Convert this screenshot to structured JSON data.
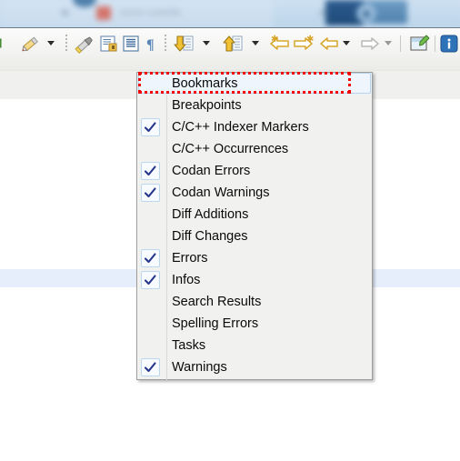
{
  "window": {
    "background_title_text": "nnnn-comtle",
    "title_strip_color": "#c6dcef"
  },
  "toolbar": {
    "items": [
      {
        "name": "pencil-marker-icon",
        "type": "icon"
      },
      {
        "name": "pencil-dropdown-arrow",
        "type": "arrow"
      },
      {
        "name": "separator-grip-1",
        "type": "grip"
      },
      {
        "name": "highlight-pen-icon",
        "type": "icon"
      },
      {
        "name": "toggle-block-selection-icon",
        "type": "icon"
      },
      {
        "name": "show-whitespace-icon",
        "type": "icon"
      },
      {
        "name": "pilcrow-icon",
        "type": "icon"
      },
      {
        "name": "separator-grip-2",
        "type": "grip"
      },
      {
        "name": "next-annotation-icon",
        "type": "icon"
      },
      {
        "name": "next-annotation-dropdown-arrow",
        "type": "arrow"
      },
      {
        "name": "previous-annotation-icon",
        "type": "icon"
      },
      {
        "name": "previous-annotation-dropdown-arrow",
        "type": "arrow"
      },
      {
        "name": "last-edit-location-icon",
        "type": "icon"
      },
      {
        "name": "forward-edit-location-icon",
        "type": "icon"
      },
      {
        "name": "back-navigation-icon",
        "type": "icon"
      },
      {
        "name": "back-navigation-dropdown-arrow",
        "type": "arrow"
      },
      {
        "name": "forward-navigation-icon",
        "type": "icon"
      },
      {
        "name": "forward-navigation-dropdown-arrow",
        "type": "arrow"
      },
      {
        "name": "separator-line-1",
        "type": "vsep"
      },
      {
        "name": "new-editor-window-icon",
        "type": "icon"
      },
      {
        "name": "separator-line-2",
        "type": "vsep"
      },
      {
        "name": "info-icon",
        "type": "icon"
      }
    ]
  },
  "menu": {
    "name": "marker-filter-menu",
    "items": [
      {
        "label": "Bookmarks",
        "checked": false,
        "highlighted": true
      },
      {
        "label": "Breakpoints",
        "checked": false,
        "highlighted": false
      },
      {
        "label": "C/C++ Indexer Markers",
        "checked": true,
        "highlighted": false
      },
      {
        "label": "C/C++ Occurrences",
        "checked": false,
        "highlighted": false
      },
      {
        "label": "Codan Errors",
        "checked": true,
        "highlighted": false
      },
      {
        "label": "Codan Warnings",
        "checked": true,
        "highlighted": false
      },
      {
        "label": "Diff Additions",
        "checked": false,
        "highlighted": false
      },
      {
        "label": "Diff Changes",
        "checked": false,
        "highlighted": false
      },
      {
        "label": "Errors",
        "checked": true,
        "highlighted": false
      },
      {
        "label": "Infos",
        "checked": true,
        "highlighted": false
      },
      {
        "label": "Search Results",
        "checked": false,
        "highlighted": false
      },
      {
        "label": "Spelling Errors",
        "checked": false,
        "highlighted": false
      },
      {
        "label": "Tasks",
        "checked": false,
        "highlighted": false
      },
      {
        "label": "Warnings",
        "checked": true,
        "highlighted": false
      }
    ]
  },
  "annotation": {
    "name": "red-dashed-highlight",
    "target_label": "Bookmarks",
    "color": "#f20000",
    "style": "dotted"
  },
  "colors": {
    "menu_background": "#f1f1ef",
    "menu_border": "#9d9d99",
    "highlight_row": "#eef5fc",
    "checkmark": "#26358c",
    "selected_row": "#e6eefb",
    "pane_header": "#f0f0ee"
  }
}
